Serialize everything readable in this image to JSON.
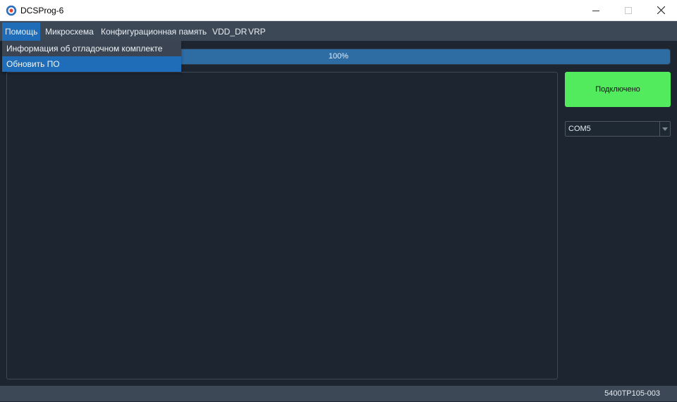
{
  "window": {
    "title": "DCSProg-6",
    "icon": "app-logo-icon"
  },
  "menubar": {
    "items": [
      {
        "label": "Помощь",
        "active": true
      },
      {
        "label": "Микросхема"
      },
      {
        "label": "Конфигурационная память"
      },
      {
        "label": "VDD_DR"
      },
      {
        "label": "VRP"
      }
    ]
  },
  "dropdown": {
    "items": [
      {
        "label": "Информация об отладочном комплекте"
      },
      {
        "label": "Обновить ПО",
        "highlighted": true
      }
    ]
  },
  "progress": {
    "value": 100,
    "label": "100%"
  },
  "connection": {
    "button_label": "Подключено",
    "color": "#52eb5e"
  },
  "port": {
    "selected": "COM5"
  },
  "status": {
    "text": "5400ТР105-003"
  },
  "colors": {
    "accent": "#1f6db8",
    "background": "#1c2530",
    "menubar": "#3d4856"
  }
}
